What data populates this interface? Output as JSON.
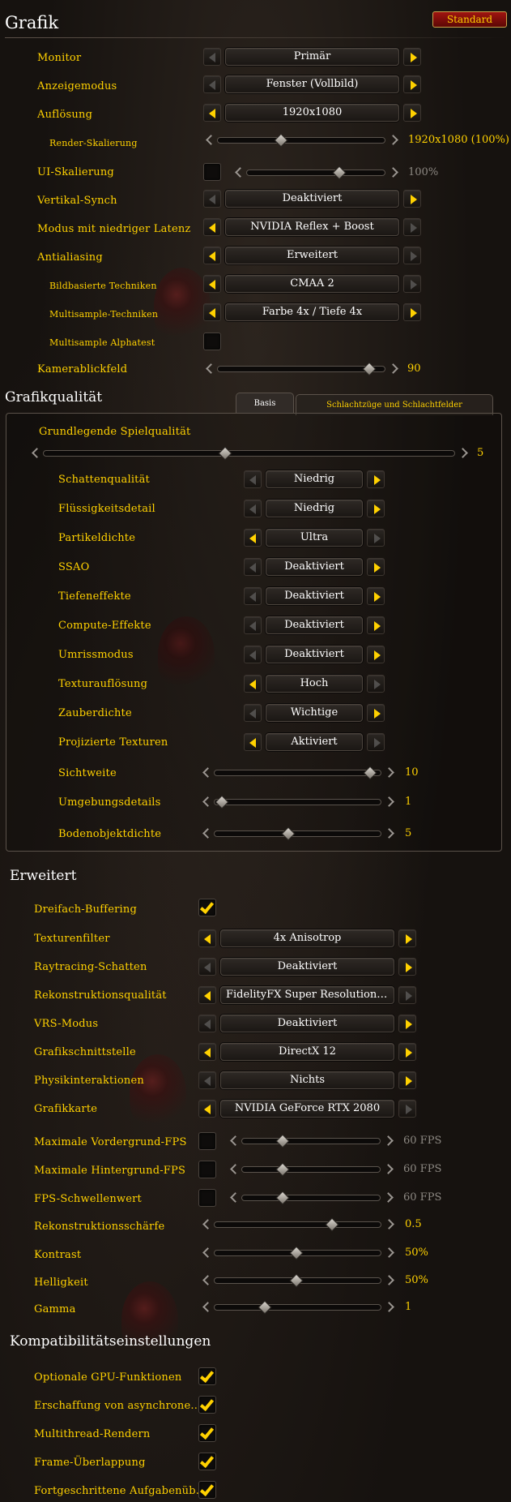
{
  "header": {
    "title": "Grafik",
    "reset_label": "Standard"
  },
  "grafik": {
    "monitor": {
      "label": "Monitor",
      "value": "Primär"
    },
    "anzeigemodus": {
      "label": "Anzeigemodus",
      "value": "Fenster (Vollbild)"
    },
    "aufloesung": {
      "label": "Auflösung",
      "value": "1920x1080"
    },
    "render_skalierung": {
      "label": "Render-Skalierung",
      "value": "1920x1080 (100%)",
      "fraction": 0.37
    },
    "ui_skalierung": {
      "label": "UI-Skalierung",
      "value": "100%",
      "checked": false,
      "fraction": 0.68
    },
    "vsync": {
      "label": "Vertikal-Synch",
      "value": "Deaktiviert"
    },
    "latenz": {
      "label": "Modus mit niedriger Latenz",
      "value": "NVIDIA Reflex + Boost"
    },
    "antialiasing": {
      "label": "Antialiasing",
      "value": "Erweitert"
    },
    "bildbasierte": {
      "label": "Bildbasierte Techniken",
      "value": "CMAA 2"
    },
    "multisample": {
      "label": "Multisample-Techniken",
      "value": "Farbe 4x / Tiefe 4x"
    },
    "alphatest": {
      "label": "Multisample Alphatest",
      "checked": false
    },
    "kamerablickfeld": {
      "label": "Kamerablickfeld",
      "value": "90",
      "fraction": 0.93
    }
  },
  "qualitaet": {
    "title": "Grafikqualität",
    "tabs": [
      "Basis",
      "Schlachtzüge und Schlachtfelder"
    ],
    "grundlegend": {
      "label": "Grundlegende Spielqualität",
      "value": "5",
      "fraction": 0.44
    },
    "rows": [
      {
        "label": "Schattenqualität",
        "value": "Niedrig"
      },
      {
        "label": "Flüssigkeitsdetail",
        "value": "Niedrig"
      },
      {
        "label": "Partikeldichte",
        "value": "Ultra"
      },
      {
        "label": "SSAO",
        "value": "Deaktiviert"
      },
      {
        "label": "Tiefeneffekte",
        "value": "Deaktiviert"
      },
      {
        "label": "Compute-Effekte",
        "value": "Deaktiviert"
      },
      {
        "label": "Umrissmodus",
        "value": "Deaktiviert"
      },
      {
        "label": "Texturauflösung",
        "value": "Hoch"
      },
      {
        "label": "Zauberdichte",
        "value": "Wichtige"
      },
      {
        "label": "Projizierte Texturen",
        "value": "Aktiviert"
      }
    ],
    "sichtweite": {
      "label": "Sichtweite",
      "value": "10",
      "fraction": 0.96
    },
    "umgebung": {
      "label": "Umgebungsdetails",
      "value": "1",
      "fraction": 0.02
    },
    "bodenobjekt": {
      "label": "Bodenobjektdichte",
      "value": "5",
      "fraction": 0.44
    }
  },
  "erweitert": {
    "title": "Erweitert",
    "dreifach": {
      "label": "Dreifach-Buffering",
      "checked": true
    },
    "texturenfilter": {
      "label": "Texturenfilter",
      "value": "4x Anisotrop"
    },
    "raytracing": {
      "label": "Raytracing-Schatten",
      "value": "Deaktiviert"
    },
    "rekonstruktion": {
      "label": "Rekonstruktionsqualität",
      "value": "FidelityFX Super Resolution 1..."
    },
    "vrs": {
      "label": "VRS-Modus",
      "value": "Deaktiviert"
    },
    "schnittstelle": {
      "label": "Grafikschnittstelle",
      "value": "DirectX 12"
    },
    "physik": {
      "label": "Physikinteraktionen",
      "value": "Nichts"
    },
    "grafikkarte": {
      "label": "Grafikkarte",
      "value": "NVIDIA GeForce RTX 2080"
    },
    "vordergrund": {
      "label": "Maximale Vordergrund-FPS",
      "value": "60 FPS",
      "fraction": 0.28
    },
    "hintergrund": {
      "label": "Maximale Hintergrund-FPS",
      "value": "60 FPS",
      "fraction": 0.28
    },
    "schwelle": {
      "label": "FPS-Schwellenwert",
      "value": "60 FPS",
      "fraction": 0.28
    },
    "schaerfe": {
      "label": "Rekonstruktionsschärfe",
      "value": "0.5",
      "fraction": 0.72
    },
    "kontrast": {
      "label": "Kontrast",
      "value": "50%",
      "fraction": 0.49
    },
    "helligkeit": {
      "label": "Helligkeit",
      "value": "50%",
      "fraction": 0.49
    },
    "gamma": {
      "label": "Gamma",
      "value": "1",
      "fraction": 0.29
    }
  },
  "kompat": {
    "title": "Kompatibilitätseinstellungen",
    "rows": [
      {
        "label": "Optionale GPU-Funktionen",
        "checked": true
      },
      {
        "label": "Erschaffung von asynchrone...",
        "checked": true
      },
      {
        "label": "Multithread-Rendern",
        "checked": true
      },
      {
        "label": "Frame-Überlappung",
        "checked": true
      },
      {
        "label": "Fortgeschrittene Aufgabenüb...",
        "checked": true
      }
    ]
  }
}
